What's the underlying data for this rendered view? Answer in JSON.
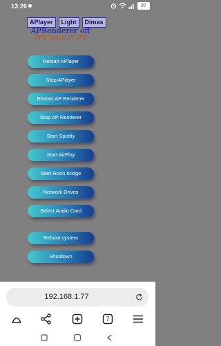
{
  "status_bar": {
    "time": "13:26",
    "battery": "97"
  },
  "tabs": [
    "APlayer",
    "Light",
    "Dimas"
  ],
  "title": "APRenderer off",
  "cpu_temp": "CPU Temp: 37.0°C",
  "buttons": [
    "Restart APlayer",
    "Stop APlayer",
    "Restart AP Renderer",
    "Stop AP Renderer",
    "Start Spotify",
    "Start AirPlay",
    "Start Roon bridge",
    "Network Drives",
    "Select Audio Card",
    "Reboot system",
    "Shutdown"
  ],
  "browser": {
    "url": "192.168.1.77",
    "tab_count": "7"
  },
  "icons": {
    "wifi": "wifi-icon",
    "battery": "battery-icon",
    "refresh": "refresh-icon",
    "home": "home-icon",
    "share": "share-icon",
    "new_tab": "new-tab-icon",
    "tabs": "tabs-icon",
    "menu": "menu-icon"
  }
}
